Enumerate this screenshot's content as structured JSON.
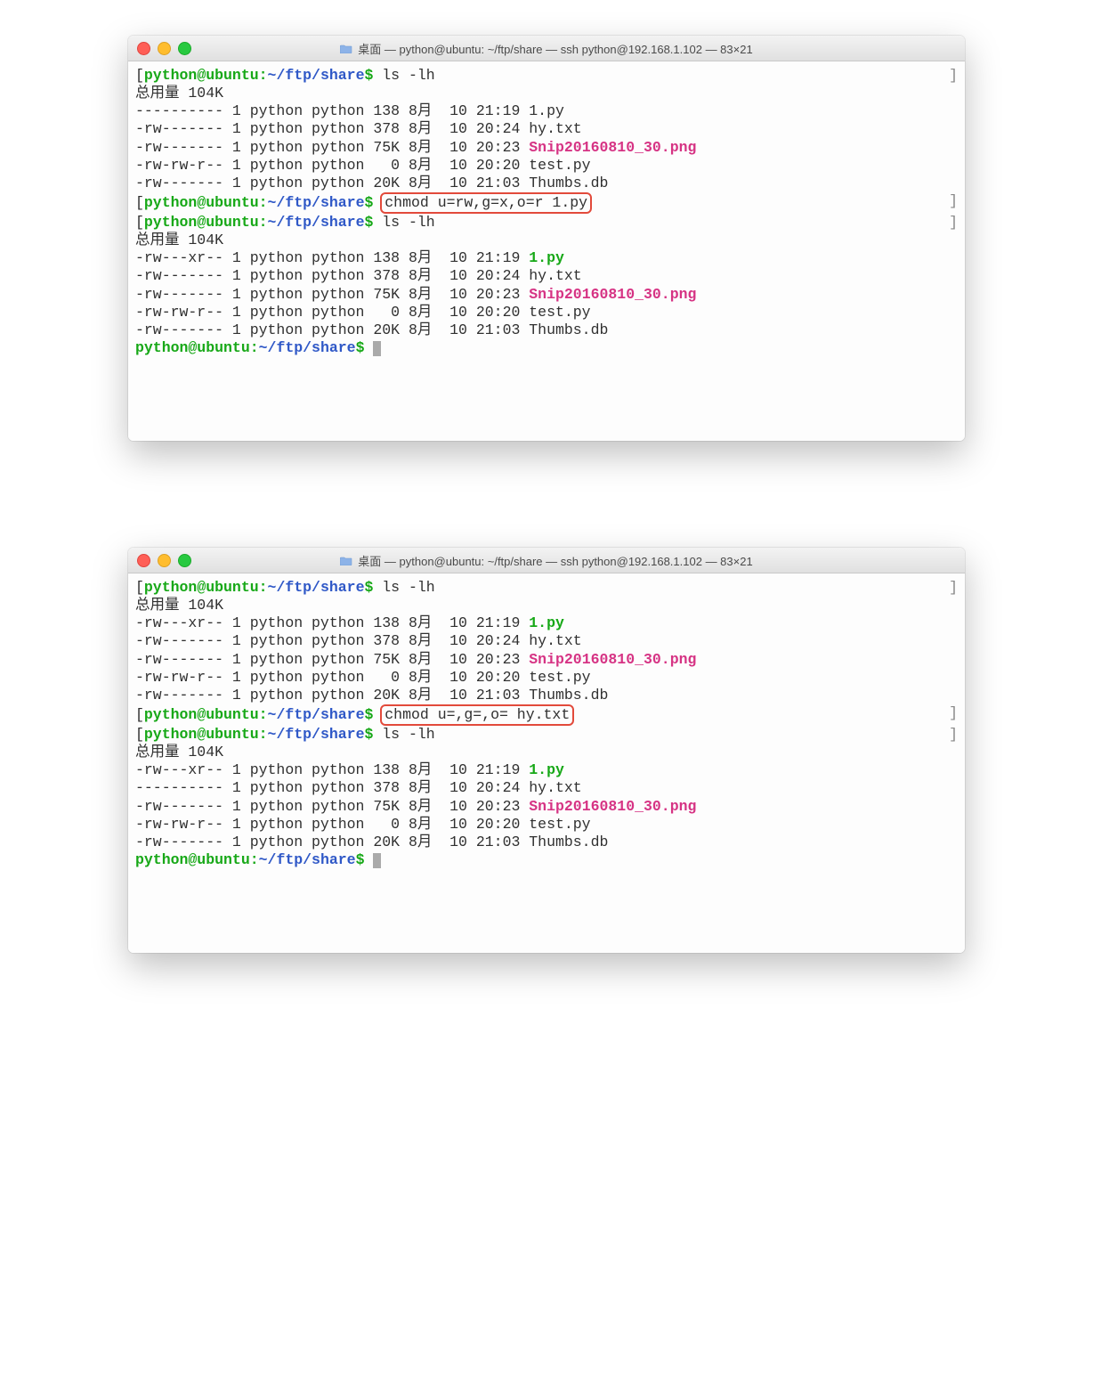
{
  "window1": {
    "title": "桌面 — python@ubuntu: ~/ftp/share — ssh python@192.168.1.102 — 83×21",
    "prompt_user": "python@ubuntu",
    "prompt_path": "~/ftp/share",
    "dollar": "$",
    "cmd1": "ls -lh",
    "header": "总用量 104K",
    "ls1": [
      {
        "perm": "----------",
        "links": "1",
        "owner": "python",
        "group": "python",
        "size": "138",
        "mon": "8月",
        "day": "10",
        "time": "21:19",
        "name": "1.py",
        "cls": ""
      },
      {
        "perm": "-rw-------",
        "links": "1",
        "owner": "python",
        "group": "python",
        "size": "378",
        "mon": "8月",
        "day": "10",
        "time": "20:24",
        "name": "hy.txt",
        "cls": ""
      },
      {
        "perm": "-rw-------",
        "links": "1",
        "owner": "python",
        "group": "python",
        "size": "75K",
        "mon": "8月",
        "day": "10",
        "time": "20:23",
        "name": "Snip20160810_30.png",
        "cls": "magenta-file"
      },
      {
        "perm": "-rw-rw-r--",
        "links": "1",
        "owner": "python",
        "group": "python",
        "size": "  0",
        "mon": "8月",
        "day": "10",
        "time": "20:20",
        "name": "test.py",
        "cls": ""
      },
      {
        "perm": "-rw-------",
        "links": "1",
        "owner": "python",
        "group": "python",
        "size": "20K",
        "mon": "8月",
        "day": "10",
        "time": "21:03",
        "name": "Thumbs.db",
        "cls": ""
      }
    ],
    "cmd_highlight": "chmod u=rw,g=x,o=r 1.py",
    "cmd2": "ls -lh",
    "ls2": [
      {
        "perm": "-rw---xr--",
        "links": "1",
        "owner": "python",
        "group": "python",
        "size": "138",
        "mon": "8月",
        "day": "10",
        "time": "21:19",
        "name": "1.py",
        "cls": "green-file"
      },
      {
        "perm": "-rw-------",
        "links": "1",
        "owner": "python",
        "group": "python",
        "size": "378",
        "mon": "8月",
        "day": "10",
        "time": "20:24",
        "name": "hy.txt",
        "cls": ""
      },
      {
        "perm": "-rw-------",
        "links": "1",
        "owner": "python",
        "group": "python",
        "size": "75K",
        "mon": "8月",
        "day": "10",
        "time": "20:23",
        "name": "Snip20160810_30.png",
        "cls": "magenta-file"
      },
      {
        "perm": "-rw-rw-r--",
        "links": "1",
        "owner": "python",
        "group": "python",
        "size": "  0",
        "mon": "8月",
        "day": "10",
        "time": "20:20",
        "name": "test.py",
        "cls": ""
      },
      {
        "perm": "-rw-------",
        "links": "1",
        "owner": "python",
        "group": "python",
        "size": "20K",
        "mon": "8月",
        "day": "10",
        "time": "21:03",
        "name": "Thumbs.db",
        "cls": ""
      }
    ]
  },
  "window2": {
    "title": "桌面 — python@ubuntu: ~/ftp/share — ssh python@192.168.1.102 — 83×21",
    "prompt_user": "python@ubuntu",
    "prompt_path": "~/ftp/share",
    "dollar": "$",
    "cmd1": "ls -lh",
    "header": "总用量 104K",
    "ls1": [
      {
        "perm": "-rw---xr--",
        "links": "1",
        "owner": "python",
        "group": "python",
        "size": "138",
        "mon": "8月",
        "day": "10",
        "time": "21:19",
        "name": "1.py",
        "cls": "green-file"
      },
      {
        "perm": "-rw-------",
        "links": "1",
        "owner": "python",
        "group": "python",
        "size": "378",
        "mon": "8月",
        "day": "10",
        "time": "20:24",
        "name": "hy.txt",
        "cls": ""
      },
      {
        "perm": "-rw-------",
        "links": "1",
        "owner": "python",
        "group": "python",
        "size": "75K",
        "mon": "8月",
        "day": "10",
        "time": "20:23",
        "name": "Snip20160810_30.png",
        "cls": "magenta-file"
      },
      {
        "perm": "-rw-rw-r--",
        "links": "1",
        "owner": "python",
        "group": "python",
        "size": "  0",
        "mon": "8月",
        "day": "10",
        "time": "20:20",
        "name": "test.py",
        "cls": ""
      },
      {
        "perm": "-rw-------",
        "links": "1",
        "owner": "python",
        "group": "python",
        "size": "20K",
        "mon": "8月",
        "day": "10",
        "time": "21:03",
        "name": "Thumbs.db",
        "cls": ""
      }
    ],
    "cmd_highlight": "chmod u=,g=,o= hy.txt",
    "cmd2": "ls -lh",
    "ls2": [
      {
        "perm": "-rw---xr--",
        "links": "1",
        "owner": "python",
        "group": "python",
        "size": "138",
        "mon": "8月",
        "day": "10",
        "time": "21:19",
        "name": "1.py",
        "cls": "green-file"
      },
      {
        "perm": "----------",
        "links": "1",
        "owner": "python",
        "group": "python",
        "size": "378",
        "mon": "8月",
        "day": "10",
        "time": "20:24",
        "name": "hy.txt",
        "cls": ""
      },
      {
        "perm": "-rw-------",
        "links": "1",
        "owner": "python",
        "group": "python",
        "size": "75K",
        "mon": "8月",
        "day": "10",
        "time": "20:23",
        "name": "Snip20160810_30.png",
        "cls": "magenta-file"
      },
      {
        "perm": "-rw-rw-r--",
        "links": "1",
        "owner": "python",
        "group": "python",
        "size": "  0",
        "mon": "8月",
        "day": "10",
        "time": "20:20",
        "name": "test.py",
        "cls": ""
      },
      {
        "perm": "-rw-------",
        "links": "1",
        "owner": "python",
        "group": "python",
        "size": "20K",
        "mon": "8月",
        "day": "10",
        "time": "21:03",
        "name": "Thumbs.db",
        "cls": ""
      }
    ]
  }
}
